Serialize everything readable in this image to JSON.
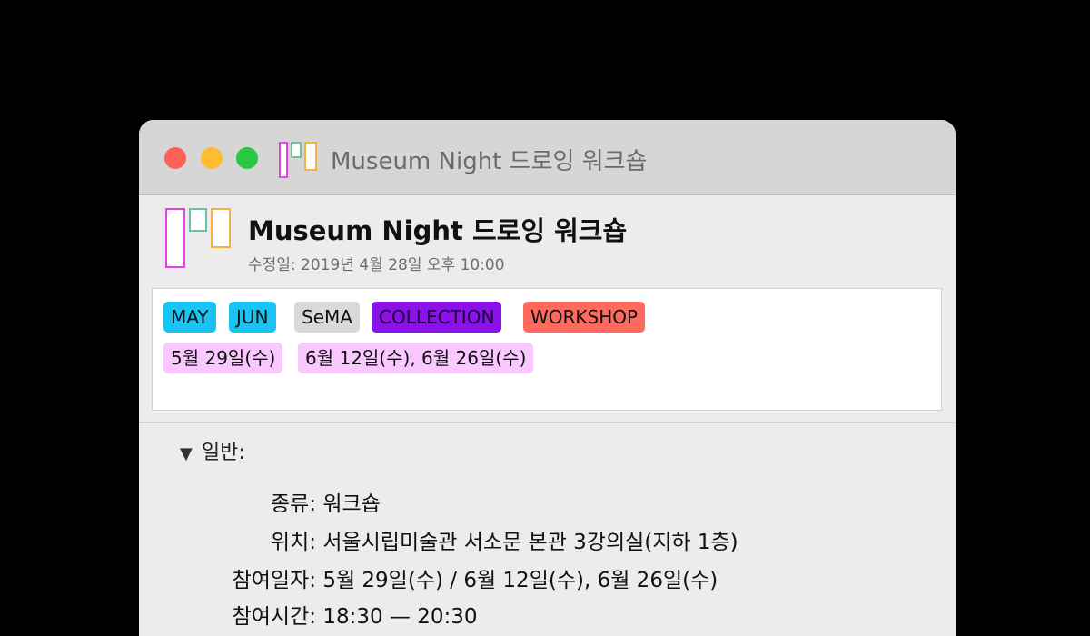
{
  "window": {
    "title": "Museum Night 드로잉 워크숍"
  },
  "header": {
    "title": "Museum Night 드로잉 워크숍",
    "modified": "수정일: 2019년 4월 28일 오후 10:00"
  },
  "tags": {
    "may": "MAY",
    "jun": "JUN",
    "sema": "SeMA",
    "collection": "COLLECTION",
    "workshop": "WORKSHOP",
    "date1": "5월 29일(수)",
    "date2": "6월 12일(수), 6월 26일(수)"
  },
  "colors": {
    "tag_blue": "#1ac4f2",
    "tag_gray": "#d9d9d9",
    "tag_purple": "#8a12e8",
    "tag_red": "#ff6a5e",
    "tag_pink": "#f8c8ff",
    "logo_magenta": "#e640e6",
    "logo_green": "#6ec19a",
    "logo_orange": "#f2b441"
  },
  "general": {
    "heading": "일반:",
    "rows": [
      {
        "label": "종류:",
        "value": "워크숍"
      },
      {
        "label": "위치:",
        "value": "서울시립미술관 서소문 본관 3강의실(지하 1층)"
      },
      {
        "label": "참여일자:",
        "value": "5월 29일(수) / 6월 12일(수), 6월 26일(수)"
      },
      {
        "label": "참여시간:",
        "value": "18:30 — 20:30"
      }
    ]
  }
}
